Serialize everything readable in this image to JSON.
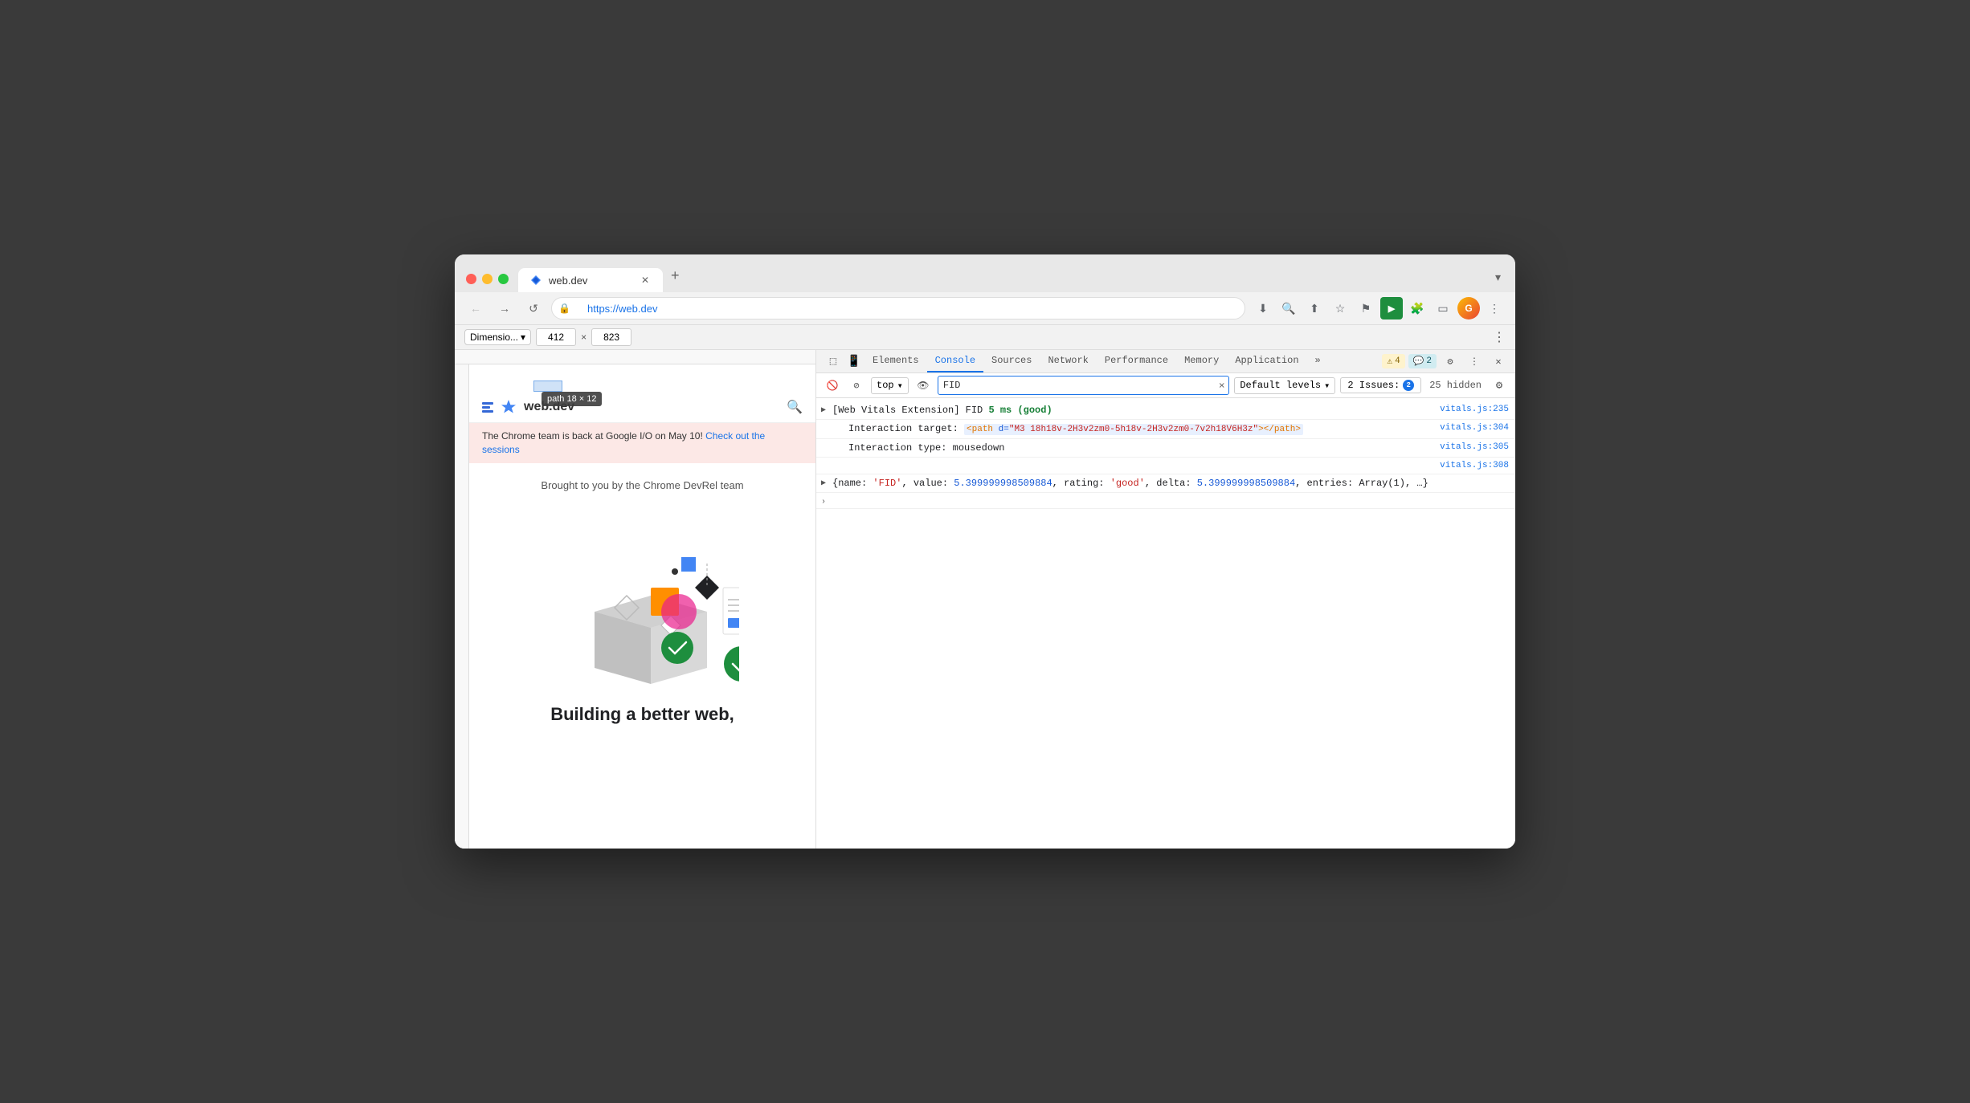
{
  "window": {
    "title": "web.dev",
    "url": "https://web.dev"
  },
  "tab": {
    "label": "web.dev",
    "favicon": "★"
  },
  "address": {
    "url": "https://web.dev",
    "lock_icon": "🔒"
  },
  "dimensions": {
    "label": "Dimensio...",
    "width": "412",
    "height": "823"
  },
  "devtools": {
    "tabs": [
      {
        "id": "elements",
        "label": "Elements",
        "active": false
      },
      {
        "id": "console",
        "label": "Console",
        "active": true
      },
      {
        "id": "sources",
        "label": "Sources",
        "active": false
      },
      {
        "id": "network",
        "label": "Network",
        "active": false
      },
      {
        "id": "performance",
        "label": "Performance",
        "active": false
      },
      {
        "id": "memory",
        "label": "Memory",
        "active": false
      },
      {
        "id": "application",
        "label": "Application",
        "active": false
      }
    ],
    "more_tabs_label": "»",
    "warn_count": "4",
    "info_count": "2",
    "settings_label": "⚙",
    "more_label": "⋮",
    "close_label": "✕"
  },
  "console_toolbar": {
    "frame_label": "top",
    "filter_value": "FID",
    "levels_label": "Default levels",
    "issues_label": "2 Issues:",
    "issues_warn": "2",
    "hidden_count": "25 hidden",
    "settings_icon": "⚙"
  },
  "console_entries": [
    {
      "id": "entry1",
      "has_toggle": true,
      "toggle_open": false,
      "prefix": "[Web Vitals Extension] FID ",
      "fid_value": "5 ms (good)",
      "source": "vitals.js:235",
      "type": "log"
    },
    {
      "id": "entry2",
      "indent": true,
      "label": "Interaction target:",
      "value": "<path d=\"M3 18h18v-2H3v2zm0-5h18v-2H3v2zm0-7v2h18V6H3z\"></path>",
      "source": "vitals.js:304",
      "type": "log"
    },
    {
      "id": "entry3",
      "indent": true,
      "label": "Interaction type:",
      "value": "mousedown",
      "source": "vitals.js:305",
      "type": "log"
    },
    {
      "id": "entry4",
      "indent": false,
      "label": "",
      "value": "",
      "source": "vitals.js:308",
      "type": "log"
    },
    {
      "id": "entry5",
      "has_toggle": true,
      "toggle_open": false,
      "content": "{name: 'FID', value: 5.399999998509884, rating: 'good', delta: 5.399999998509884, entries: Array(1), …}",
      "source": "",
      "type": "log"
    }
  ],
  "webdev": {
    "logo_text": "web.dev",
    "banner_text": "The Chrome team is back at Google I/O on May 10! Check out the sessions",
    "banner_link_text": "Check out the sessions",
    "subtitle": "Brought to you by the Chrome DevRel team",
    "heading": "Building a better web,",
    "tooltip": "path  18 × 12"
  },
  "highlight": {
    "label": "path",
    "dimensions": "18 × 12"
  }
}
